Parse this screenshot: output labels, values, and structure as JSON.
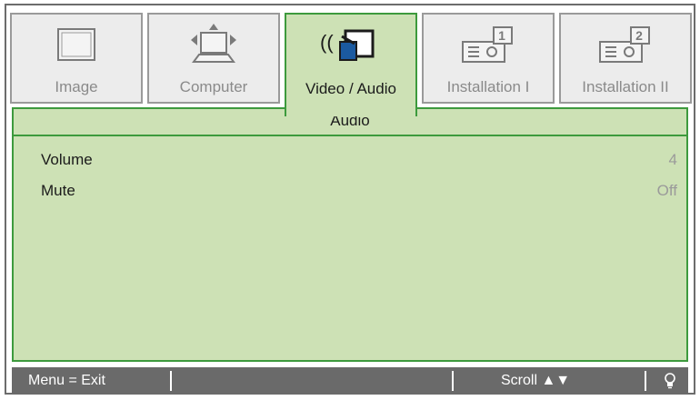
{
  "tabs": [
    {
      "label": "Image",
      "icon": "image-monitor-icon",
      "active": false
    },
    {
      "label": "Computer",
      "icon": "computer-icon",
      "active": false
    },
    {
      "label": "Video / Audio",
      "icon": "video-audio-icon",
      "active": true
    },
    {
      "label": "Installation I",
      "icon": "installation-projector-icon",
      "active": false
    },
    {
      "label": "Installation II",
      "icon": "installation-projector-icon",
      "active": false
    }
  ],
  "section": {
    "title": "Audio"
  },
  "settings": [
    {
      "name": "Volume",
      "value": "4"
    },
    {
      "name": "Mute",
      "value": "Off"
    }
  ],
  "footer": {
    "menu_hint": "Menu = Exit",
    "scroll_hint": "Scroll ▲▼",
    "tip_icon": "lightbulb-icon"
  },
  "colors": {
    "active_green": "#3d9a3d",
    "panel_bg": "#cde1b5",
    "footer_bg": "#6a6a6a"
  }
}
